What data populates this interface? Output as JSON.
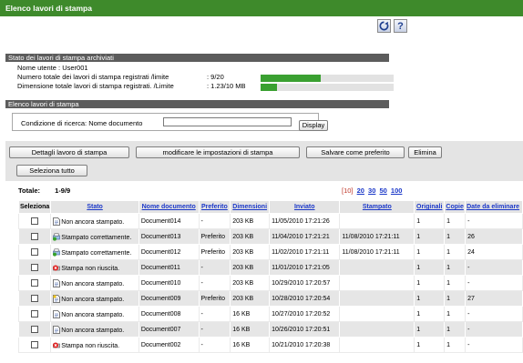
{
  "header": {
    "title": "Elenco lavori di stampa"
  },
  "icons": {
    "refresh": "refresh-icon",
    "help": "help-icon"
  },
  "archive": {
    "section_title": "Stato dei lavori di stampa archiviati",
    "user_label": "Nome utente : User001",
    "count_label": "Numero totale dei lavori di stampa registrati /limite",
    "count_value": ":    9/20",
    "count_progress": 0.45,
    "size_label": "Dimensione totale lavori di stampa registrati. /Limite",
    "size_value": ":    1.23/10 MB",
    "size_progress": 0.123
  },
  "list": {
    "section_title": "Elenco lavori di stampa",
    "search_label": "Condizione di ricerca:   Nome documento",
    "search_value": "",
    "display_label": "Display"
  },
  "actions": {
    "details": "Dettagli lavoro di stampa",
    "modify": "modificare le impostazioni di stampa",
    "save_pref": "Salvare come preferito",
    "delete": "Elimina",
    "select_all": "Seleziona tutto"
  },
  "totals": {
    "label": "Totale:",
    "range": "1-9/9",
    "pager_current": "[10]",
    "pager_links": [
      "20",
      "30",
      "50",
      "100"
    ]
  },
  "table": {
    "headers": [
      "Seleziona",
      "Stato",
      "Nome documento",
      "Preferito",
      "Dimensioni",
      "Inviato",
      "Stampato",
      "Originali",
      "Copie",
      "Date da eliminare"
    ],
    "rows": [
      {
        "status": "Non ancora stampato.",
        "icon": "doc-icon",
        "doc": "Document014",
        "pref": "-",
        "size": "203 KB",
        "sent": "11/05/2010 17:21:26",
        "printed": "",
        "orig": "1",
        "copies": "1",
        "del": "-"
      },
      {
        "status": "Stampato correttamente.",
        "icon": "printed-ok-icon",
        "doc": "Document013",
        "pref": "Preferito",
        "size": "203 KB",
        "sent": "11/04/2010 17:21:21",
        "printed": "11/08/2010 17:21:11",
        "orig": "1",
        "copies": "1",
        "del": "26"
      },
      {
        "status": "Stampato correttamente.",
        "icon": "printed-ok-icon",
        "doc": "Document012",
        "pref": "Preferito",
        "size": "203 KB",
        "sent": "11/02/2010 17:21:11",
        "printed": "11/08/2010 17:21:11",
        "orig": "1",
        "copies": "1",
        "del": "24"
      },
      {
        "status": "Stampa non riuscita.",
        "icon": "error-icon",
        "doc": "Document011",
        "pref": "-",
        "size": "203 KB",
        "sent": "11/01/2010 17:21:05",
        "printed": "",
        "orig": "1",
        "copies": "1",
        "del": "-"
      },
      {
        "status": "Non ancora stampato.",
        "icon": "doc-icon",
        "doc": "Document010",
        "pref": "-",
        "size": "203 KB",
        "sent": "10/29/2010 17:20:57",
        "printed": "",
        "orig": "1",
        "copies": "1",
        "del": "-"
      },
      {
        "status": "Non ancora stampato.",
        "icon": "doc-fav-icon",
        "doc": "Document009",
        "pref": "Preferito",
        "size": "203 KB",
        "sent": "10/28/2010 17:20:54",
        "printed": "",
        "orig": "1",
        "copies": "1",
        "del": "27"
      },
      {
        "status": "Non ancora stampato.",
        "icon": "doc-icon",
        "doc": "Document008",
        "pref": "-",
        "size": "16 KB",
        "sent": "10/27/2010 17:20:52",
        "printed": "",
        "orig": "1",
        "copies": "1",
        "del": "-"
      },
      {
        "status": "Non ancora stampato.",
        "icon": "doc-icon",
        "doc": "Document007",
        "pref": "-",
        "size": "16 KB",
        "sent": "10/26/2010 17:20:51",
        "printed": "",
        "orig": "1",
        "copies": "1",
        "del": "-"
      },
      {
        "status": "Stampa non riuscita.",
        "icon": "error-icon",
        "doc": "Document002",
        "pref": "-",
        "size": "16 KB",
        "sent": "10/21/2010 17:20:38",
        "printed": "",
        "orig": "1",
        "copies": "1",
        "del": "-"
      }
    ]
  }
}
